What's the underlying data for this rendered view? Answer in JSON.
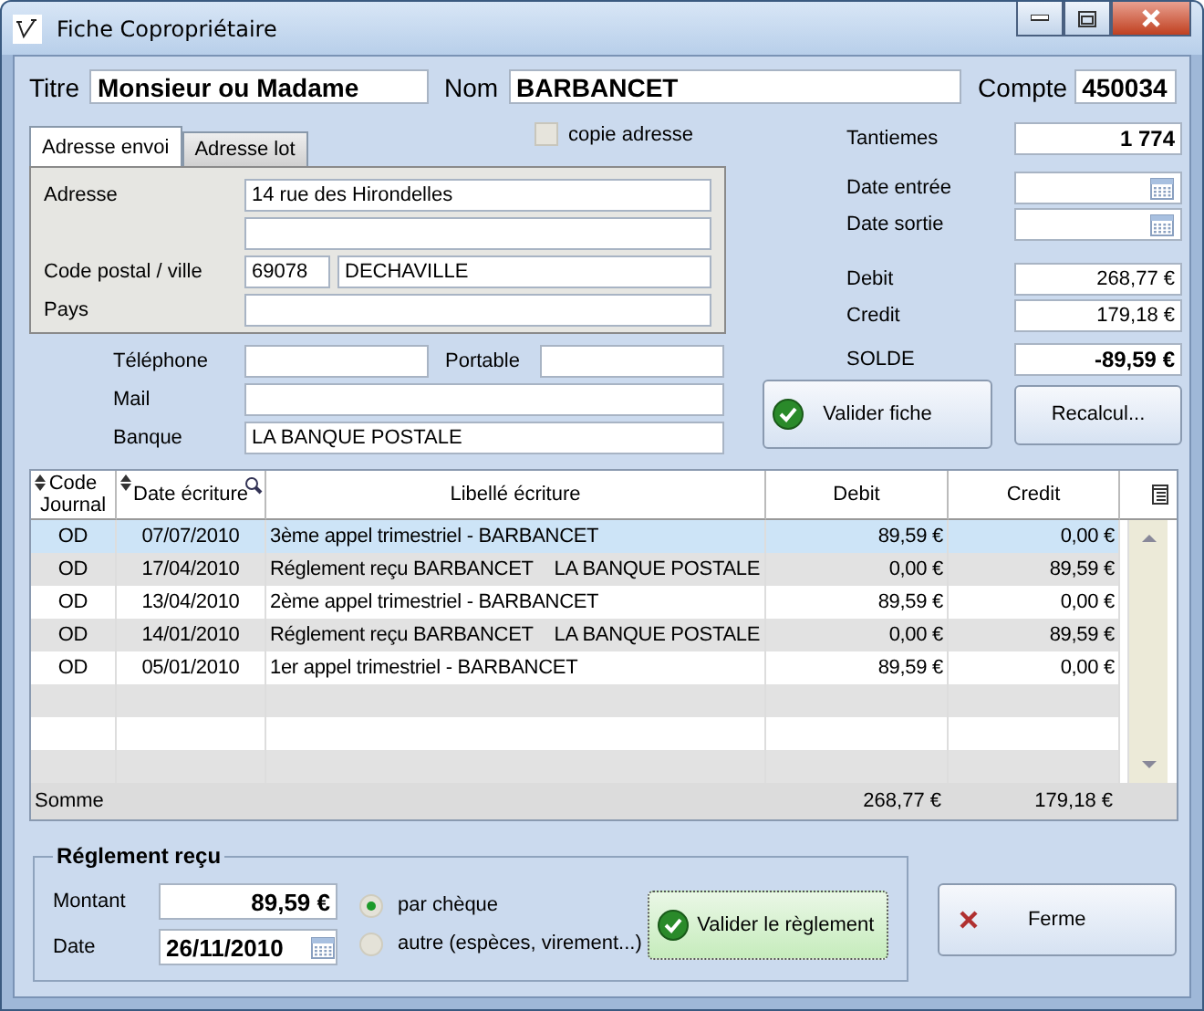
{
  "window": {
    "title": "Fiche Copropriétaire"
  },
  "header": {
    "titre_label": "Titre",
    "titre": "Monsieur ou Madame",
    "nom_label": "Nom",
    "nom": "BARBANCET",
    "compte_label": "Compte",
    "compte": "450034"
  },
  "address_tabs": [
    {
      "label": "Adresse envoi",
      "selected": true
    },
    {
      "label": "Adresse lot",
      "selected": false
    }
  ],
  "copie_adresse": {
    "label": "copie adresse",
    "checked": false
  },
  "address": {
    "adresse_label": "Adresse",
    "adresse": "14 rue des Hirondelles",
    "code_postal_label": "Code postal / ville",
    "code_postal": "69078",
    "ville": "DECHAVILLE",
    "pays_label": "Pays"
  },
  "contact": {
    "telephone_label": "Téléphone",
    "portable_label": "Portable",
    "mail_label": "Mail",
    "banque_label": "Banque",
    "banque": "LA BANQUE POSTALE"
  },
  "summary": {
    "tantiemes_label": "Tantiemes",
    "tantiemes": "1 774",
    "date_entree_label": "Date entrée",
    "date_sortie_label": "Date sortie",
    "debit_label": "Debit",
    "debit": "268,77 €",
    "credit_label": "Credit",
    "credit": "179,18 €",
    "solde_label": "SOLDE",
    "solde": "-89,59 €"
  },
  "buttons": {
    "valider_fiche": "Valider fiche",
    "recalcul": "Recalcul...",
    "ferme": "Ferme"
  },
  "table": {
    "columns": [
      "Code Journal",
      "Date écriture",
      "Libellé écriture",
      "Debit",
      "Credit"
    ],
    "rows": [
      {
        "code": "OD",
        "date": "07/07/2010",
        "libelle": "3ème appel trimestriel - BARBANCET",
        "debit": "89,59 €",
        "credit": "0,00 €",
        "selected": true
      },
      {
        "code": "OD",
        "date": "17/04/2010",
        "libelle": "Réglement reçu BARBANCET    LA BANQUE POSTALE",
        "debit": "0,00 €",
        "credit": "89,59 €",
        "selected": false
      },
      {
        "code": "OD",
        "date": "13/04/2010",
        "libelle": "2ème appel trimestriel - BARBANCET",
        "debit": "89,59 €",
        "credit": "0,00 €",
        "selected": false
      },
      {
        "code": "OD",
        "date": "14/01/2010",
        "libelle": "Réglement reçu BARBANCET    LA BANQUE POSTALE",
        "debit": "0,00 €",
        "credit": "89,59 €",
        "selected": false
      },
      {
        "code": "OD",
        "date": "05/01/2010",
        "libelle": "1er appel trimestriel - BARBANCET",
        "debit": "89,59 €",
        "credit": "0,00 €",
        "selected": false
      }
    ],
    "footer": {
      "label": "Somme",
      "debit": "268,77 €",
      "credit": "179,18 €"
    }
  },
  "reglement": {
    "title": "Réglement reçu",
    "montant_label": "Montant",
    "montant": "89,59 €",
    "date_label": "Date",
    "date": "26/11/2010",
    "button": "Valider le règlement",
    "options": [
      {
        "label": "par chèque",
        "selected": true
      },
      {
        "label": "autre (espèces, virement...)",
        "selected": false
      }
    ]
  }
}
